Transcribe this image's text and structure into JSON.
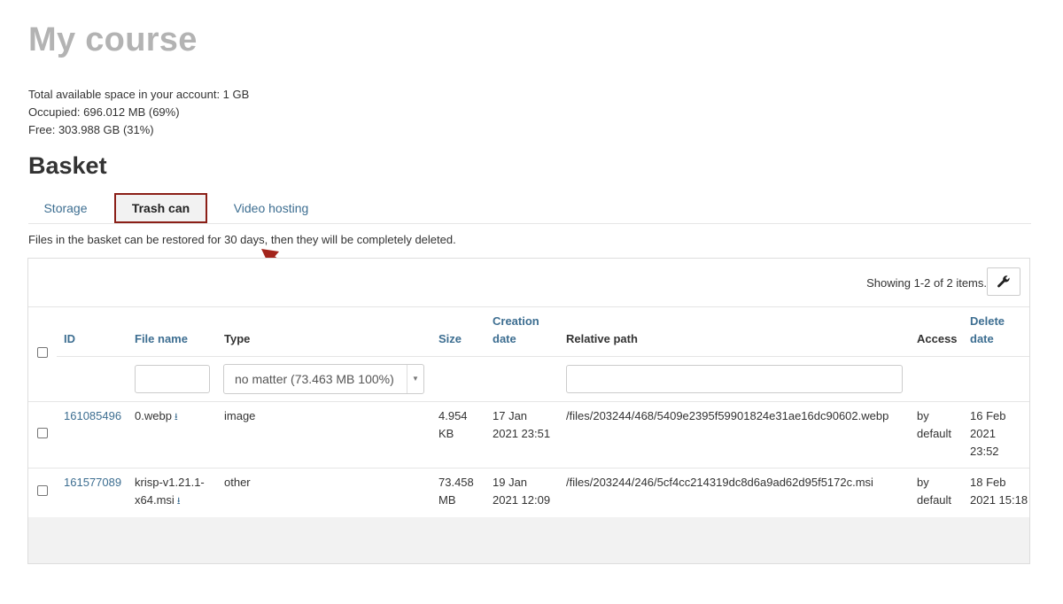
{
  "page": {
    "title": "My course"
  },
  "quota": {
    "total": "Total available space in your account: 1 GB",
    "occupied": "Occupied: 696.012 MB (69%)",
    "free": "Free: 303.988 GB (31%)"
  },
  "basket": {
    "title": "Basket"
  },
  "tabs": [
    {
      "label": "Storage",
      "active": false
    },
    {
      "label": "Trash can",
      "active": true
    },
    {
      "label": "Video hosting",
      "active": false
    }
  ],
  "notice": "Files in the basket can be restored for 30 days, then they will be completely deleted.",
  "grid": {
    "summary": "Showing 1-2 of 2 items.",
    "columns": {
      "id": "ID",
      "file_name": "File name",
      "type": "Type",
      "size": "Size",
      "creation_date_1": "Creation",
      "creation_date_2": "date",
      "relative_path": "Relative path",
      "access": "Access",
      "delete_date_1": "Delete",
      "delete_date_2": "date"
    },
    "filters": {
      "type_selected": "no matter (73.463 MB 100%)",
      "file_name": "",
      "relative_path": ""
    },
    "rows": [
      {
        "id": "161085496",
        "file_name_1": "0.webp",
        "file_name_2": "",
        "type": "image",
        "size_1": "4.954",
        "size_2": "KB",
        "created_1": "17 Jan",
        "created_2": "2021 23:51",
        "path": "/files/203244/468/5409e2395f59901824e31ae16dc90602.webp",
        "access_1": "by",
        "access_2": "default",
        "deleted_1": "16 Feb",
        "deleted_2": "2021",
        "deleted_3": "23:52"
      },
      {
        "id": "161577089",
        "file_name_1": "krisp-v1.21.1-",
        "file_name_2": "x64.msi",
        "type": "other",
        "size_1": "73.458",
        "size_2": "MB",
        "created_1": "19 Jan",
        "created_2": "2021 12:09",
        "path": "/files/203244/246/5cf4cc214319dc8d6a9ad62d95f5172c.msi",
        "access_1": "by",
        "access_2": "default",
        "deleted_1": "18 Feb",
        "deleted_2": "2021 15:18",
        "deleted_3": ""
      }
    ]
  },
  "colors": {
    "link": "#3d6e91",
    "active_tab_border": "#8b1f17",
    "arrow": "#a3241b",
    "title_gray": "#b3b3b3"
  },
  "icons": {
    "download": "download-icon",
    "settings": "wrench-icon",
    "annotation": "arrow-annotation"
  }
}
